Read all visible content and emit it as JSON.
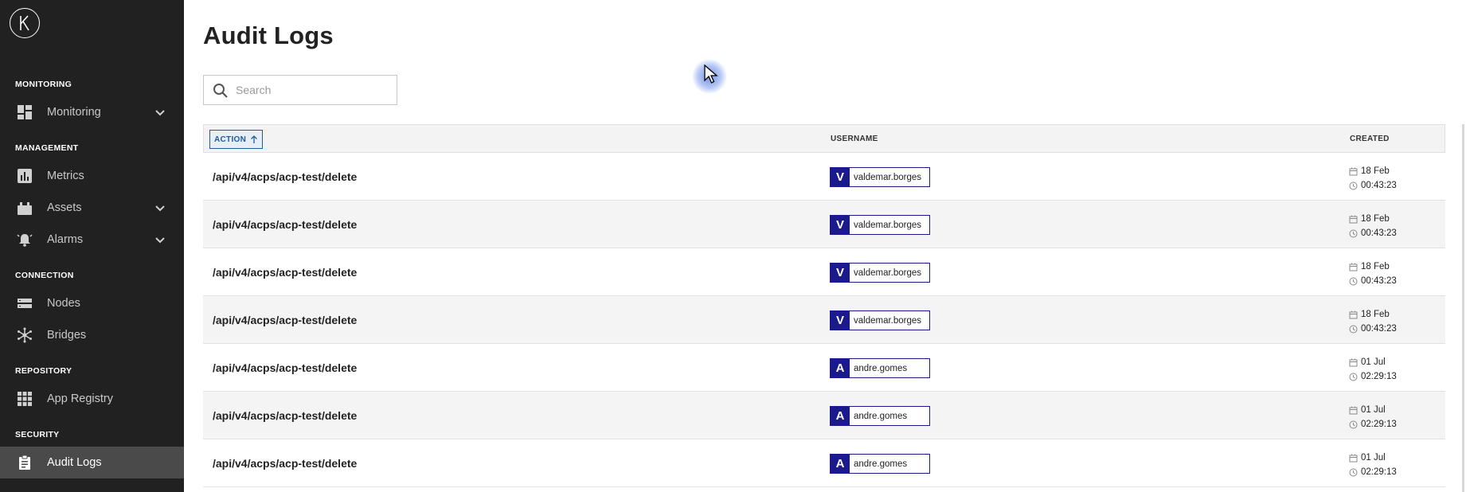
{
  "sidebar": {
    "logo_letter": "K",
    "sections": [
      {
        "title": "MONITORING",
        "items": [
          {
            "label": "Monitoring",
            "icon": "dashboard-icon",
            "expandable": true
          }
        ]
      },
      {
        "title": "MANAGEMENT",
        "items": [
          {
            "label": "Metrics",
            "icon": "chart-icon",
            "expandable": false
          },
          {
            "label": "Assets",
            "icon": "assets-icon",
            "expandable": true
          },
          {
            "label": "Alarms",
            "icon": "alarm-icon",
            "expandable": true
          }
        ]
      },
      {
        "title": "CONNECTION",
        "items": [
          {
            "label": "Nodes",
            "icon": "nodes-icon",
            "expandable": false
          },
          {
            "label": "Bridges",
            "icon": "bridges-icon",
            "expandable": false
          }
        ]
      },
      {
        "title": "REPOSITORY",
        "items": [
          {
            "label": "App Registry",
            "icon": "grid-icon",
            "expandable": false
          }
        ]
      },
      {
        "title": "SECURITY",
        "items": [
          {
            "label": "Audit Logs",
            "icon": "clipboard-icon",
            "expandable": false,
            "active": true
          }
        ]
      }
    ]
  },
  "page": {
    "title": "Audit Logs"
  },
  "search": {
    "placeholder": "Search",
    "value": ""
  },
  "table": {
    "columns": {
      "action": "ACTION",
      "username": "USERNAME",
      "created": "CREATED"
    },
    "sort": {
      "column": "action",
      "direction": "ascending"
    },
    "rows": [
      {
        "action": "/api/v4/acps/acp-test/delete",
        "avatar": "V",
        "username": "valdemar.borges",
        "date": "18 Feb",
        "time": "00:43:23"
      },
      {
        "action": "/api/v4/acps/acp-test/delete",
        "avatar": "V",
        "username": "valdemar.borges",
        "date": "18 Feb",
        "time": "00:43:23"
      },
      {
        "action": "/api/v4/acps/acp-test/delete",
        "avatar": "V",
        "username": "valdemar.borges",
        "date": "18 Feb",
        "time": "00:43:23"
      },
      {
        "action": "/api/v4/acps/acp-test/delete",
        "avatar": "V",
        "username": "valdemar.borges",
        "date": "18 Feb",
        "time": "00:43:23"
      },
      {
        "action": "/api/v4/acps/acp-test/delete",
        "avatar": "A",
        "username": "andre.gomes",
        "date": "01 Jul",
        "time": "02:29:13"
      },
      {
        "action": "/api/v4/acps/acp-test/delete",
        "avatar": "A",
        "username": "andre.gomes",
        "date": "01 Jul",
        "time": "02:29:13"
      },
      {
        "action": "/api/v4/acps/acp-test/delete",
        "avatar": "A",
        "username": "andre.gomes",
        "date": "01 Jul",
        "time": "02:29:13"
      }
    ]
  },
  "colors": {
    "sidebar_bg": "#212121",
    "active_bg": "#4a4a4a",
    "accent": "#1a1a8c",
    "sort_accent": "#1e5c9e"
  }
}
